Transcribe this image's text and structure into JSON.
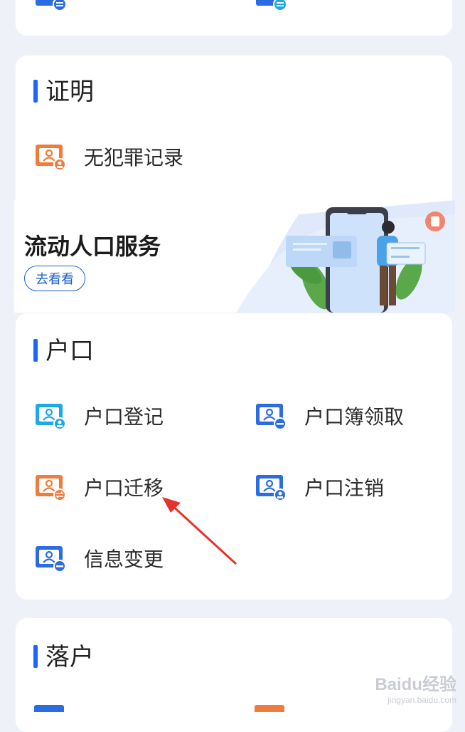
{
  "top_card": {
    "items": [
      {
        "label": "",
        "icon": "id-card-icon"
      },
      {
        "label": "",
        "icon": "id-card-icon"
      }
    ]
  },
  "certificate": {
    "title": "证明",
    "items": [
      {
        "label": "无犯罪记录",
        "icon": "id-card-stamp-icon",
        "color": "#f07b3c"
      }
    ]
  },
  "banner": {
    "title": "流动人口服务",
    "button": "去看看"
  },
  "hukou": {
    "title": "户口",
    "items": [
      {
        "label": "户口登记",
        "icon": "id-card-stamp-icon",
        "color": "#1fa8e6"
      },
      {
        "label": "户口簿领取",
        "icon": "id-card-minus-icon",
        "color": "#2b6de0"
      },
      {
        "label": "户口迁移",
        "icon": "id-card-transfer-icon",
        "color": "#f07b3c"
      },
      {
        "label": "户口注销",
        "icon": "id-card-stamp-icon",
        "color": "#2b6de0"
      },
      {
        "label": "信息变更",
        "icon": "id-card-minus-icon",
        "color": "#2b6de0"
      }
    ]
  },
  "settle": {
    "title": "落户"
  },
  "watermark": {
    "text": "Baidu经验",
    "sub": "jingyan.baidu.com"
  },
  "colors": {
    "accent": "#1a66ff",
    "arrow": "#e8312a"
  }
}
